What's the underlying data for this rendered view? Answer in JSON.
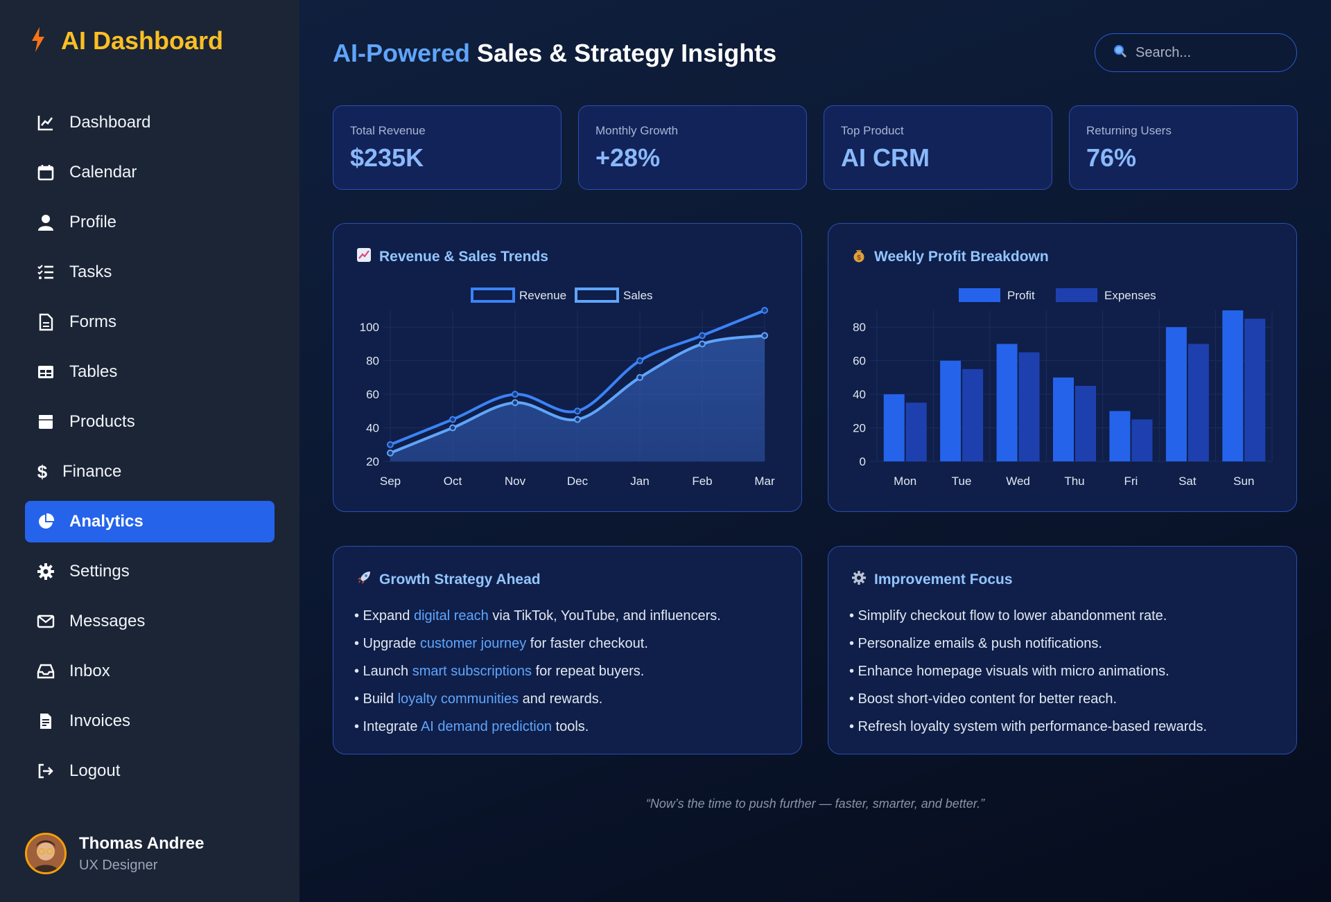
{
  "brand": {
    "name": "AI Dashboard",
    "icon": "bolt-icon"
  },
  "sidebar": {
    "items": [
      {
        "label": "Dashboard",
        "icon": "chart-line-icon"
      },
      {
        "label": "Calendar",
        "icon": "calendar-icon"
      },
      {
        "label": "Profile",
        "icon": "user-icon"
      },
      {
        "label": "Tasks",
        "icon": "list-check-icon"
      },
      {
        "label": "Forms",
        "icon": "file-icon"
      },
      {
        "label": "Tables",
        "icon": "table-icon"
      },
      {
        "label": "Products",
        "icon": "box-icon"
      },
      {
        "label": "Finance",
        "icon": "dollar-icon"
      },
      {
        "label": "Analytics",
        "icon": "pie-chart-icon",
        "active": true
      },
      {
        "label": "Settings",
        "icon": "gear-icon"
      },
      {
        "label": "Messages",
        "icon": "envelope-icon"
      },
      {
        "label": "Inbox",
        "icon": "inbox-icon"
      },
      {
        "label": "Invoices",
        "icon": "invoice-icon"
      },
      {
        "label": "Logout",
        "icon": "logout-icon"
      }
    ]
  },
  "user": {
    "name": "Thomas Andree",
    "role": "UX Designer"
  },
  "header": {
    "title_accent": "AI-Powered",
    "title_rest": " Sales & Strategy Insights",
    "search_placeholder": "Search..."
  },
  "stats": [
    {
      "label": "Total Revenue",
      "value": "$235K"
    },
    {
      "label": "Monthly Growth",
      "value": "+28%"
    },
    {
      "label": "Top Product",
      "value": "AI CRM"
    },
    {
      "label": "Returning Users",
      "value": "76%"
    }
  ],
  "charts_titles": {
    "revenue": "Revenue & Sales Trends",
    "profit": "Weekly Profit Breakdown"
  },
  "chart_data": [
    {
      "type": "line",
      "title": "Revenue & Sales Trends",
      "categories": [
        "Sep",
        "Oct",
        "Nov",
        "Dec",
        "Jan",
        "Feb",
        "Mar"
      ],
      "series": [
        {
          "name": "Revenue",
          "values": [
            30,
            45,
            60,
            50,
            80,
            95,
            110
          ],
          "color": "#3b82f6"
        },
        {
          "name": "Sales",
          "values": [
            25,
            40,
            55,
            45,
            70,
            90,
            95
          ],
          "color": "#60a5fa"
        }
      ],
      "yticks": [
        20,
        40,
        60,
        80,
        100
      ],
      "ylim": [
        20,
        110
      ],
      "legend": "top-center",
      "grid": true
    },
    {
      "type": "bar",
      "title": "Weekly Profit Breakdown",
      "categories": [
        "Mon",
        "Tue",
        "Wed",
        "Thu",
        "Fri",
        "Sat",
        "Sun"
      ],
      "series": [
        {
          "name": "Profit",
          "values": [
            40,
            60,
            70,
            50,
            30,
            80,
            90
          ],
          "color": "#2563eb"
        },
        {
          "name": "Expenses",
          "values": [
            35,
            55,
            65,
            45,
            25,
            70,
            85
          ],
          "color": "#1e40af"
        }
      ],
      "yticks": [
        0,
        20,
        40,
        60,
        80
      ],
      "ylim": [
        0,
        90
      ],
      "legend": "top-center",
      "grid": true
    }
  ],
  "growth": {
    "title": "Growth Strategy Ahead",
    "items": [
      {
        "pre": "• Expand ",
        "hl": "digital reach",
        "post": " via TikTok, YouTube, and influencers."
      },
      {
        "pre": "• Upgrade ",
        "hl": "customer journey",
        "post": " for faster checkout."
      },
      {
        "pre": "• Launch ",
        "hl": "smart subscriptions",
        "post": " for repeat buyers."
      },
      {
        "pre": "• Build ",
        "hl": "loyalty communities",
        "post": " and rewards."
      },
      {
        "pre": "• Integrate ",
        "hl": "AI demand prediction",
        "post": " tools."
      }
    ]
  },
  "improvement": {
    "title": "Improvement Focus",
    "items": [
      "• Simplify checkout flow to lower abandonment rate.",
      "• Personalize emails & push notifications.",
      "• Enhance homepage visuals with micro animations.",
      "• Boost short-video content for better reach.",
      "• Refresh loyalty system with performance-based rewards."
    ]
  },
  "quote": "“Now’s the time to push further — faster, smarter, and better.”",
  "colors": {
    "accent": "#2563eb",
    "brand": "#fbbf24",
    "highlight": "#60a5fa"
  }
}
